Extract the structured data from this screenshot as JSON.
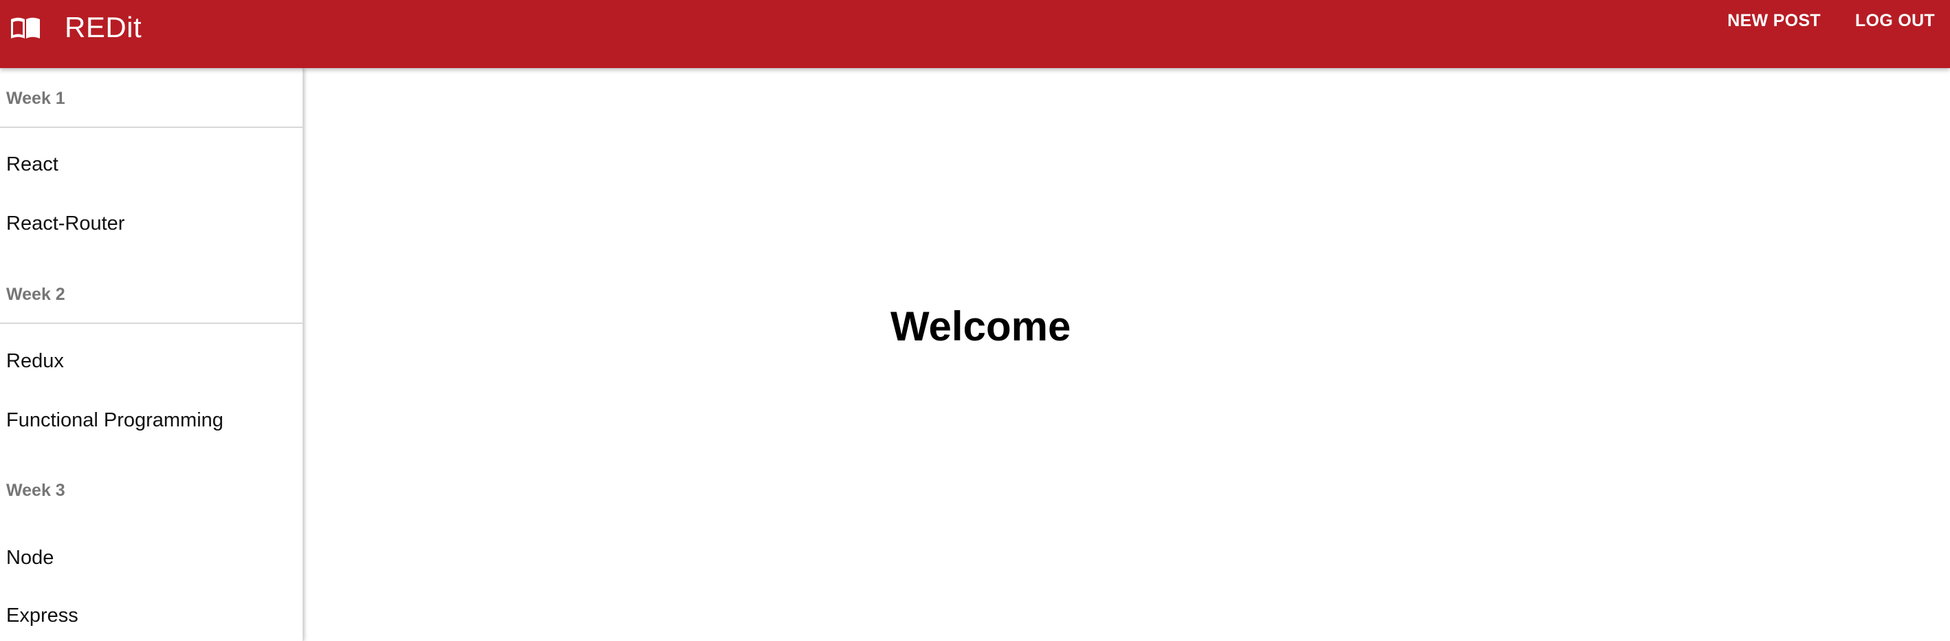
{
  "appbar": {
    "icon": "open-book-icon",
    "title": "REDit",
    "actions": [
      {
        "label": "NEW POST"
      },
      {
        "label": "LOG OUT"
      }
    ],
    "color": "#b71c24"
  },
  "sidebar": {
    "sections": [
      {
        "header": "Week 1",
        "items": [
          "React",
          "React-Router"
        ]
      },
      {
        "header": "Week 2",
        "items": [
          "Redux",
          "Functional Programming"
        ]
      },
      {
        "header": "Week 3",
        "items": [
          "Node",
          "Express"
        ]
      }
    ]
  },
  "main": {
    "heading": "Welcome"
  }
}
